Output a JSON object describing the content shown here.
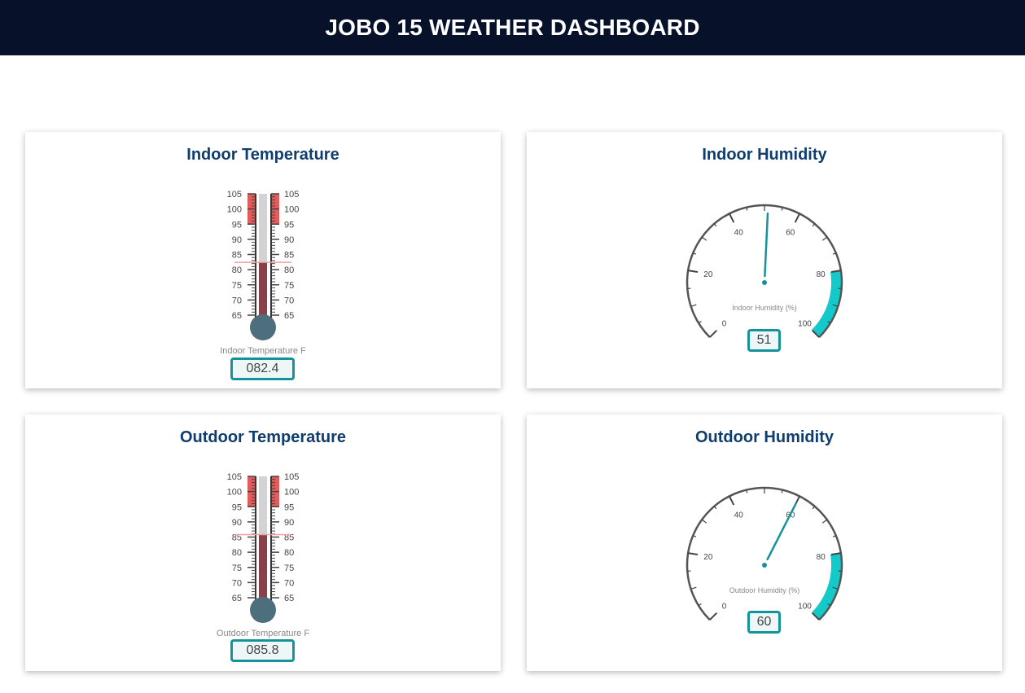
{
  "header": {
    "title": "JOBO 15 WEATHER DASHBOARD"
  },
  "colors": {
    "header_bg": "#07112a",
    "card_title": "#0f3d6e",
    "accent_teal": "#16939a",
    "gauge_band": "#13c9c9",
    "mercury": "#8a4048",
    "bulb": "#4d6e7d",
    "danger_zone": "#e25c5c"
  },
  "cards": {
    "indoor_temperature": {
      "title": "Indoor Temperature",
      "label": "Indoor Temperature F",
      "value_text": "082.4",
      "value": 82.4,
      "scale_min": 65,
      "scale_max": 105,
      "danger_from": 95,
      "ticks": [
        "105",
        "100",
        "95",
        "90",
        "85",
        "80",
        "75",
        "70",
        "65"
      ]
    },
    "outdoor_temperature": {
      "title": "Outdoor Temperature",
      "label": "Outdoor Temperature F",
      "value_text": "085.8",
      "value": 85.8,
      "scale_min": 65,
      "scale_max": 105,
      "danger_from": 95,
      "ticks": [
        "105",
        "100",
        "95",
        "90",
        "85",
        "80",
        "75",
        "70",
        "65"
      ]
    },
    "indoor_humidity": {
      "title": "Indoor Humidity",
      "label": "Indoor Humidity (%)",
      "value_text": "51",
      "value": 51,
      "scale_min": 0,
      "scale_max": 100,
      "band_from": 80,
      "ticks": [
        "0",
        "20",
        "40",
        "60",
        "80",
        "100"
      ]
    },
    "outdoor_humidity": {
      "title": "Outdoor Humidity",
      "label": "Outdoor Humidity (%)",
      "value_text": "60",
      "value": 60,
      "scale_min": 0,
      "scale_max": 100,
      "band_from": 80,
      "ticks": [
        "0",
        "20",
        "40",
        "60",
        "80",
        "100"
      ]
    }
  }
}
